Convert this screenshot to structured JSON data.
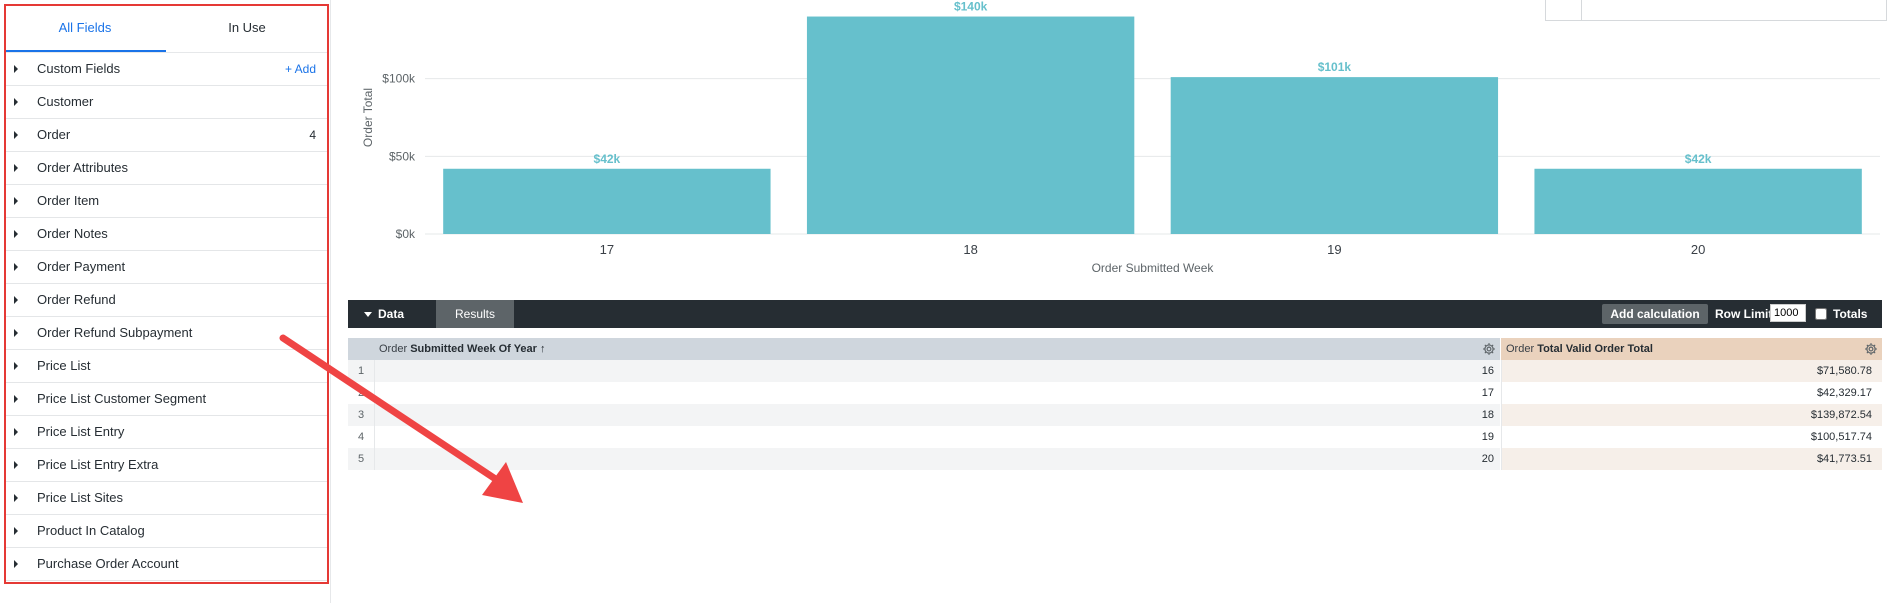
{
  "sidebar": {
    "tabs": [
      {
        "label": "All Fields",
        "active": true
      },
      {
        "label": "In Use",
        "active": false
      }
    ],
    "add_label": "+ Add",
    "fields": [
      {
        "label": "Custom Fields",
        "count": ""
      },
      {
        "label": "Customer",
        "count": ""
      },
      {
        "label": "Order",
        "count": "4"
      },
      {
        "label": "Order Attributes",
        "count": ""
      },
      {
        "label": "Order Item",
        "count": ""
      },
      {
        "label": "Order Notes",
        "count": ""
      },
      {
        "label": "Order Payment",
        "count": ""
      },
      {
        "label": "Order Refund",
        "count": ""
      },
      {
        "label": "Order Refund Subpayment",
        "count": ""
      },
      {
        "label": "Price List",
        "count": ""
      },
      {
        "label": "Price List Customer Segment",
        "count": ""
      },
      {
        "label": "Price List Entry",
        "count": ""
      },
      {
        "label": "Price List Entry Extra",
        "count": ""
      },
      {
        "label": "Price List Sites",
        "count": ""
      },
      {
        "label": "Product In Catalog",
        "count": ""
      },
      {
        "label": "Purchase Order Account",
        "count": ""
      }
    ]
  },
  "chart_data": {
    "type": "bar",
    "categories": [
      "17",
      "18",
      "19",
      "20"
    ],
    "values": [
      42,
      140,
      101,
      42
    ],
    "value_labels": [
      "$42k",
      "$140k",
      "$101k",
      "$42k"
    ],
    "xlabel": "Order Submitted Week",
    "ylabel": "Order Total",
    "yticks": [
      0,
      50,
      100
    ],
    "ytick_labels": [
      "$0k",
      "$50k",
      "$100k"
    ],
    "ylim": [
      0,
      150
    ],
    "grid": true,
    "bar_color": "#66c0cc",
    "label_color": "#66c0cc"
  },
  "databar": {
    "data_tab": "Data",
    "results_tab": "Results",
    "add_calc": "Add calculation",
    "row_limit_label": "Row Limit",
    "row_limit_value": "1000",
    "totals_label": "Totals"
  },
  "table": {
    "dim_header": {
      "view": "Order",
      "field": "Submitted Week Of Year",
      "sort": "↑"
    },
    "meas_header": {
      "view": "Order",
      "field": "Total Valid Order Total"
    },
    "rows": [
      {
        "index": "1",
        "week": "16",
        "total": "$71,580.78"
      },
      {
        "index": "2",
        "week": "17",
        "total": "$42,329.17"
      },
      {
        "index": "3",
        "week": "18",
        "total": "$139,872.54"
      },
      {
        "index": "4",
        "week": "19",
        "total": "$100,517.74"
      },
      {
        "index": "5",
        "week": "20",
        "total": "$41,773.51"
      }
    ]
  },
  "colors": {
    "accent": "#1a73e8",
    "annotation": "#e53935",
    "bar": "#66c0cc",
    "dark_bar": "#262d33"
  }
}
